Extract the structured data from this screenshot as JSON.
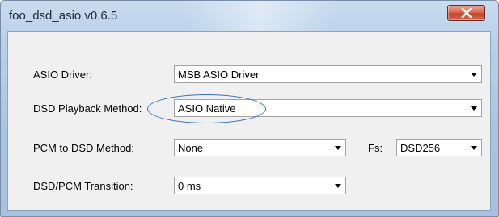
{
  "window": {
    "title": "foo_dsd_asio v0.6.5",
    "close_icon": "close-x-icon"
  },
  "form": {
    "asio_driver": {
      "label": "ASIO Driver:",
      "value": "MSB ASIO Driver"
    },
    "dsd_playback_method": {
      "label": "DSD Playback Method:",
      "value": "ASIO Native"
    },
    "pcm_to_dsd_method": {
      "label": "PCM to DSD Method:",
      "value": "None"
    },
    "fs": {
      "label": "Fs:",
      "value": "DSD256"
    },
    "dsd_pcm_transition": {
      "label": "DSD/PCM Transition:",
      "value": "0 ms"
    }
  },
  "colors": {
    "highlight_ellipse": "#2f6fc0",
    "close_button": "#c5452f"
  }
}
